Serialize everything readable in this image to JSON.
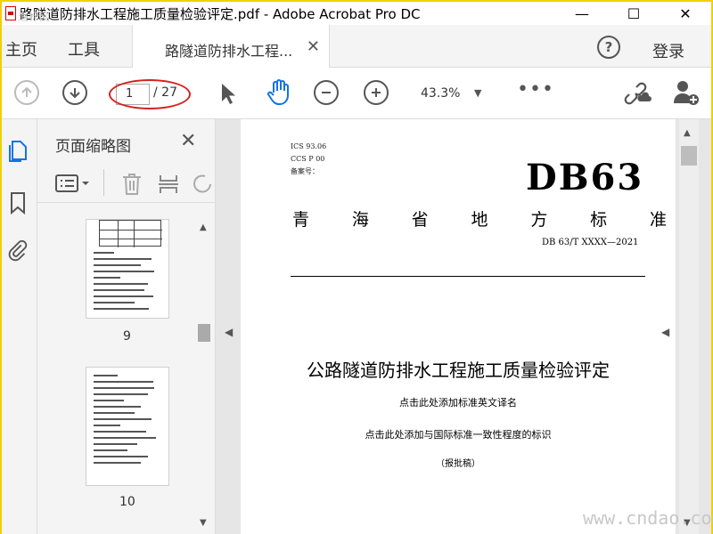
{
  "window": {
    "title": "路隧道防排水工程施工质量检验评定.pdf - Adobe Acrobat Pro DC",
    "minimize": "—",
    "maximize": "☐",
    "close": "✕"
  },
  "tabs": {
    "home": "主页",
    "tools": "工具",
    "doc": "路隧道防排水工程...",
    "doc_close": "✕",
    "help": "?",
    "login": "登录"
  },
  "toolbar": {
    "page_current": "1",
    "page_total": "/ 27",
    "zoom": "43.3%",
    "zoom_caret": "▼",
    "more": "•••"
  },
  "thumbnails": {
    "heading": "页面缩略图",
    "close": "✕",
    "pages": [
      {
        "label": "9"
      },
      {
        "label": "10"
      }
    ]
  },
  "document": {
    "ics": "ICS 93.06",
    "ccs": "CCS P 00",
    "record": "备案号：",
    "code": "DB63",
    "province": [
      "青",
      "海",
      "省",
      "地",
      "方",
      "标",
      "准"
    ],
    "standard_no": "DB 63/T XXXX—2021",
    "title": "公路隧道防排水工程施工质量检验评定",
    "english_hint": "点击此处添加标准英文译名",
    "consistency_hint": "点击此处添加与国际标准一致性程度的标识",
    "status": "（报批稿）"
  },
  "watermark": "www.cndao.com",
  "watermark_top": "道标网",
  "colors": {
    "accent_blue": "#1473e6",
    "ellipse_red": "#d62020",
    "frame_yellow": "#f0d000"
  }
}
